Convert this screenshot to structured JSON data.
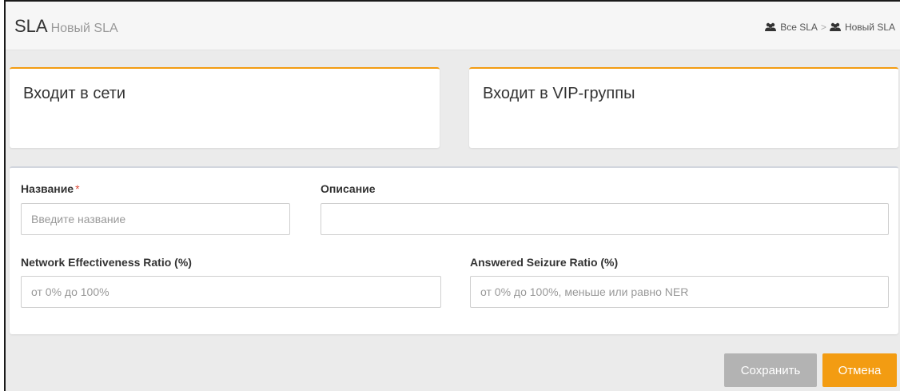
{
  "header": {
    "title": "SLA",
    "subtitle": "Новый SLA",
    "breadcrumb": [
      {
        "label": "Все SLA",
        "icon": "users-icon"
      },
      {
        "label": "Новый SLA",
        "icon": "users-icon"
      }
    ],
    "separator": ">"
  },
  "cards": [
    {
      "title": "Входит в сети"
    },
    {
      "title": "Входит в VIP-группы"
    }
  ],
  "form": {
    "name_label": "Название",
    "required_mark": "*",
    "name_placeholder": "Введите название",
    "description_label": "Описание",
    "description_value": "",
    "ner_label": "Network Effectiveness Ratio (%)",
    "ner_placeholder": "от 0% до 100%",
    "asr_label": "Answered Seizure Ratio (%)",
    "asr_placeholder": "от 0% до 100%, меньше или равно NER"
  },
  "actions": {
    "save_label": "Сохранить",
    "cancel_label": "Отмена"
  },
  "colors": {
    "accent": "#f39c12",
    "save_button": "#b3b3b3",
    "required": "#dd4b39"
  }
}
